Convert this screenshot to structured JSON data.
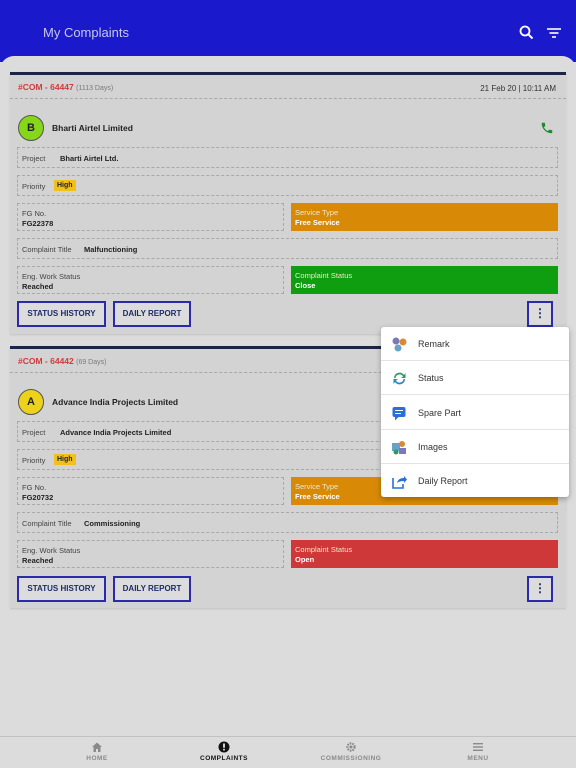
{
  "header": {
    "title": "My Complaints",
    "search_icon": "search-icon",
    "filter_icon": "filter-icon",
    "background": "#1a1acc"
  },
  "complaints": [
    {
      "id": "#COM - 64447",
      "days": "(1113 Days)",
      "datetime": "21 Feb 20 | 10:11 AM",
      "initial": "B",
      "avatar_color": "#86d61a",
      "customer": "Bharti Airtel Limited",
      "project_label": "Project",
      "project": "Bharti Airtel Ltd.",
      "priority_label": "Priority",
      "priority": "High",
      "fg_label": "FG No.",
      "fg_no": "FG22378",
      "service_type_label": "Service Type",
      "service_type": "Free Service",
      "title_label": "Complaint Title",
      "title": "Malfunctioning",
      "eng_status_label": "Eng. Work Status",
      "eng_status": "Reached",
      "complaint_status_label": "Complaint Status",
      "complaint_status": "Close",
      "status_color": "#0f9e0f",
      "status_history_label": "STATUS HISTORY",
      "daily_report_label": "DAILY REPORT",
      "more_label": "⋮"
    },
    {
      "id": "#COM - 64442",
      "days": "(69 Days)",
      "datetime": "",
      "initial": "A",
      "avatar_color": "#ecd21a",
      "customer": "Advance India Projects Limited",
      "project_label": "Project",
      "project": "Advance India Projects Limited",
      "priority_label": "Priority",
      "priority": "High",
      "fg_label": "FG No.",
      "fg_no": "FG20732",
      "service_type_label": "Service Type",
      "service_type": "Free Service",
      "title_label": "Complaint Title",
      "title": "Commissioning",
      "eng_status_label": "Eng. Work Status",
      "eng_status": "Reached",
      "complaint_status_label": "Complaint Status",
      "complaint_status": "Open",
      "status_color": "#cf3838",
      "status_history_label": "STATUS HISTORY",
      "daily_report_label": "DAILY REPORT",
      "more_label": "⋮"
    }
  ],
  "service_type_color": "#d88a06",
  "popup_menu": {
    "items": [
      {
        "label": "Remark",
        "icon": "remark-icon"
      },
      {
        "label": "Status",
        "icon": "status-icon"
      },
      {
        "label": "Spare Part",
        "icon": "spare-part-icon"
      },
      {
        "label": "Images",
        "icon": "images-icon"
      },
      {
        "label": "Daily Report",
        "icon": "daily-report-icon"
      }
    ]
  },
  "bottom_nav": {
    "items": [
      {
        "label": "HOME",
        "icon": "home-icon",
        "active": false
      },
      {
        "label": "COMPLAINTS",
        "icon": "complaints-icon",
        "active": true
      },
      {
        "label": "COMMISSIONING",
        "icon": "gear-icon",
        "active": false
      },
      {
        "label": "MENU",
        "icon": "menu-icon",
        "active": false
      }
    ]
  }
}
